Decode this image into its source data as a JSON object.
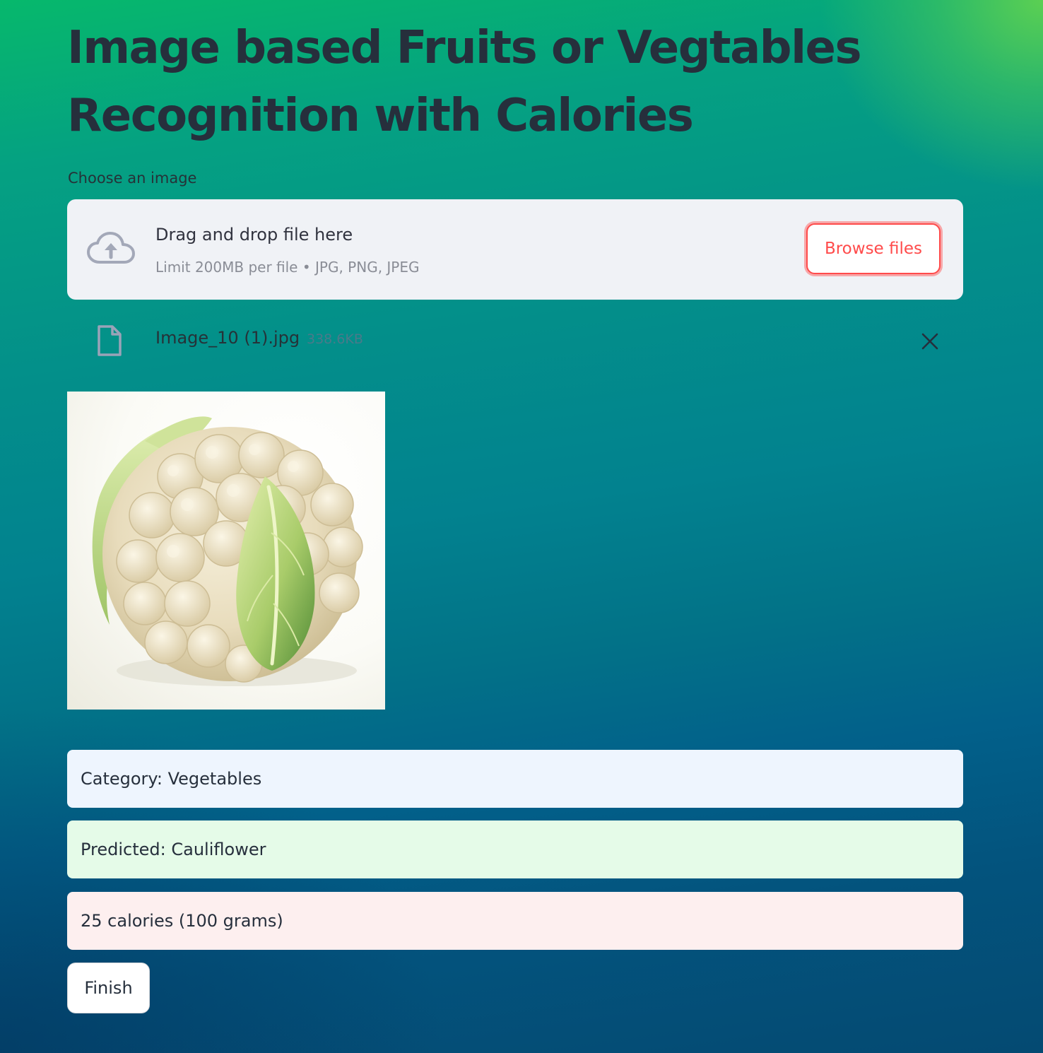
{
  "header": {
    "title": "Image based Fruits or Vegtables Recognition with Calories"
  },
  "uploader": {
    "label": "Choose an image",
    "drop_title": "Drag and drop file here",
    "limit_text": "Limit 200MB per file • JPG, PNG, JPEG",
    "browse_label": "Browse files",
    "icon": "cloud-upload-icon"
  },
  "uploaded_file": {
    "name": "Image_10 (1).jpg",
    "size": "338.6KB",
    "icon": "file-icon",
    "remove_icon": "close-icon"
  },
  "preview": {
    "subject": "cauliflower"
  },
  "results": {
    "category": "Category: Vegetables",
    "predicted": "Predicted: Cauliflower",
    "calories": "25 calories (100 grams)"
  },
  "actions": {
    "finish_label": "Finish"
  },
  "colors": {
    "accent": "#ff4b4b",
    "info_bg": "#eef5fe",
    "success_bg": "#e5fbe8",
    "error_bg": "#fdefef",
    "text": "#262f3c"
  }
}
